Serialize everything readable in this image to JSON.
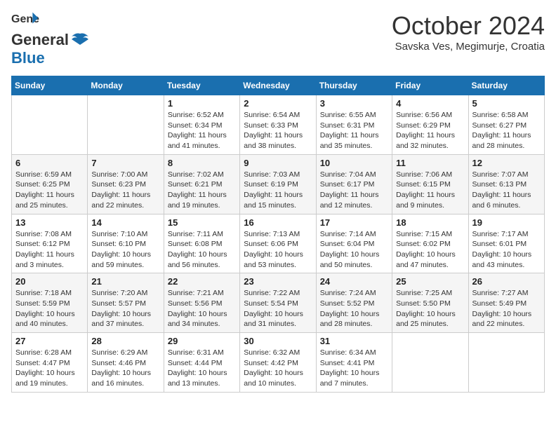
{
  "header": {
    "logo_general": "General",
    "logo_blue": "Blue",
    "month_title": "October 2024",
    "location": "Savska Ves, Megimurje, Croatia"
  },
  "weekdays": [
    "Sunday",
    "Monday",
    "Tuesday",
    "Wednesday",
    "Thursday",
    "Friday",
    "Saturday"
  ],
  "weeks": [
    [
      {
        "day": "",
        "sunrise": "",
        "sunset": "",
        "daylight": ""
      },
      {
        "day": "",
        "sunrise": "",
        "sunset": "",
        "daylight": ""
      },
      {
        "day": "1",
        "sunrise": "Sunrise: 6:52 AM",
        "sunset": "Sunset: 6:34 PM",
        "daylight": "Daylight: 11 hours and 41 minutes."
      },
      {
        "day": "2",
        "sunrise": "Sunrise: 6:54 AM",
        "sunset": "Sunset: 6:33 PM",
        "daylight": "Daylight: 11 hours and 38 minutes."
      },
      {
        "day": "3",
        "sunrise": "Sunrise: 6:55 AM",
        "sunset": "Sunset: 6:31 PM",
        "daylight": "Daylight: 11 hours and 35 minutes."
      },
      {
        "day": "4",
        "sunrise": "Sunrise: 6:56 AM",
        "sunset": "Sunset: 6:29 PM",
        "daylight": "Daylight: 11 hours and 32 minutes."
      },
      {
        "day": "5",
        "sunrise": "Sunrise: 6:58 AM",
        "sunset": "Sunset: 6:27 PM",
        "daylight": "Daylight: 11 hours and 28 minutes."
      }
    ],
    [
      {
        "day": "6",
        "sunrise": "Sunrise: 6:59 AM",
        "sunset": "Sunset: 6:25 PM",
        "daylight": "Daylight: 11 hours and 25 minutes."
      },
      {
        "day": "7",
        "sunrise": "Sunrise: 7:00 AM",
        "sunset": "Sunset: 6:23 PM",
        "daylight": "Daylight: 11 hours and 22 minutes."
      },
      {
        "day": "8",
        "sunrise": "Sunrise: 7:02 AM",
        "sunset": "Sunset: 6:21 PM",
        "daylight": "Daylight: 11 hours and 19 minutes."
      },
      {
        "day": "9",
        "sunrise": "Sunrise: 7:03 AM",
        "sunset": "Sunset: 6:19 PM",
        "daylight": "Daylight: 11 hours and 15 minutes."
      },
      {
        "day": "10",
        "sunrise": "Sunrise: 7:04 AM",
        "sunset": "Sunset: 6:17 PM",
        "daylight": "Daylight: 11 hours and 12 minutes."
      },
      {
        "day": "11",
        "sunrise": "Sunrise: 7:06 AM",
        "sunset": "Sunset: 6:15 PM",
        "daylight": "Daylight: 11 hours and 9 minutes."
      },
      {
        "day": "12",
        "sunrise": "Sunrise: 7:07 AM",
        "sunset": "Sunset: 6:13 PM",
        "daylight": "Daylight: 11 hours and 6 minutes."
      }
    ],
    [
      {
        "day": "13",
        "sunrise": "Sunrise: 7:08 AM",
        "sunset": "Sunset: 6:12 PM",
        "daylight": "Daylight: 11 hours and 3 minutes."
      },
      {
        "day": "14",
        "sunrise": "Sunrise: 7:10 AM",
        "sunset": "Sunset: 6:10 PM",
        "daylight": "Daylight: 10 hours and 59 minutes."
      },
      {
        "day": "15",
        "sunrise": "Sunrise: 7:11 AM",
        "sunset": "Sunset: 6:08 PM",
        "daylight": "Daylight: 10 hours and 56 minutes."
      },
      {
        "day": "16",
        "sunrise": "Sunrise: 7:13 AM",
        "sunset": "Sunset: 6:06 PM",
        "daylight": "Daylight: 10 hours and 53 minutes."
      },
      {
        "day": "17",
        "sunrise": "Sunrise: 7:14 AM",
        "sunset": "Sunset: 6:04 PM",
        "daylight": "Daylight: 10 hours and 50 minutes."
      },
      {
        "day": "18",
        "sunrise": "Sunrise: 7:15 AM",
        "sunset": "Sunset: 6:02 PM",
        "daylight": "Daylight: 10 hours and 47 minutes."
      },
      {
        "day": "19",
        "sunrise": "Sunrise: 7:17 AM",
        "sunset": "Sunset: 6:01 PM",
        "daylight": "Daylight: 10 hours and 43 minutes."
      }
    ],
    [
      {
        "day": "20",
        "sunrise": "Sunrise: 7:18 AM",
        "sunset": "Sunset: 5:59 PM",
        "daylight": "Daylight: 10 hours and 40 minutes."
      },
      {
        "day": "21",
        "sunrise": "Sunrise: 7:20 AM",
        "sunset": "Sunset: 5:57 PM",
        "daylight": "Daylight: 10 hours and 37 minutes."
      },
      {
        "day": "22",
        "sunrise": "Sunrise: 7:21 AM",
        "sunset": "Sunset: 5:56 PM",
        "daylight": "Daylight: 10 hours and 34 minutes."
      },
      {
        "day": "23",
        "sunrise": "Sunrise: 7:22 AM",
        "sunset": "Sunset: 5:54 PM",
        "daylight": "Daylight: 10 hours and 31 minutes."
      },
      {
        "day": "24",
        "sunrise": "Sunrise: 7:24 AM",
        "sunset": "Sunset: 5:52 PM",
        "daylight": "Daylight: 10 hours and 28 minutes."
      },
      {
        "day": "25",
        "sunrise": "Sunrise: 7:25 AM",
        "sunset": "Sunset: 5:50 PM",
        "daylight": "Daylight: 10 hours and 25 minutes."
      },
      {
        "day": "26",
        "sunrise": "Sunrise: 7:27 AM",
        "sunset": "Sunset: 5:49 PM",
        "daylight": "Daylight: 10 hours and 22 minutes."
      }
    ],
    [
      {
        "day": "27",
        "sunrise": "Sunrise: 6:28 AM",
        "sunset": "Sunset: 4:47 PM",
        "daylight": "Daylight: 10 hours and 19 minutes."
      },
      {
        "day": "28",
        "sunrise": "Sunrise: 6:29 AM",
        "sunset": "Sunset: 4:46 PM",
        "daylight": "Daylight: 10 hours and 16 minutes."
      },
      {
        "day": "29",
        "sunrise": "Sunrise: 6:31 AM",
        "sunset": "Sunset: 4:44 PM",
        "daylight": "Daylight: 10 hours and 13 minutes."
      },
      {
        "day": "30",
        "sunrise": "Sunrise: 6:32 AM",
        "sunset": "Sunset: 4:42 PM",
        "daylight": "Daylight: 10 hours and 10 minutes."
      },
      {
        "day": "31",
        "sunrise": "Sunrise: 6:34 AM",
        "sunset": "Sunset: 4:41 PM",
        "daylight": "Daylight: 10 hours and 7 minutes."
      },
      {
        "day": "",
        "sunrise": "",
        "sunset": "",
        "daylight": ""
      },
      {
        "day": "",
        "sunrise": "",
        "sunset": "",
        "daylight": ""
      }
    ]
  ]
}
